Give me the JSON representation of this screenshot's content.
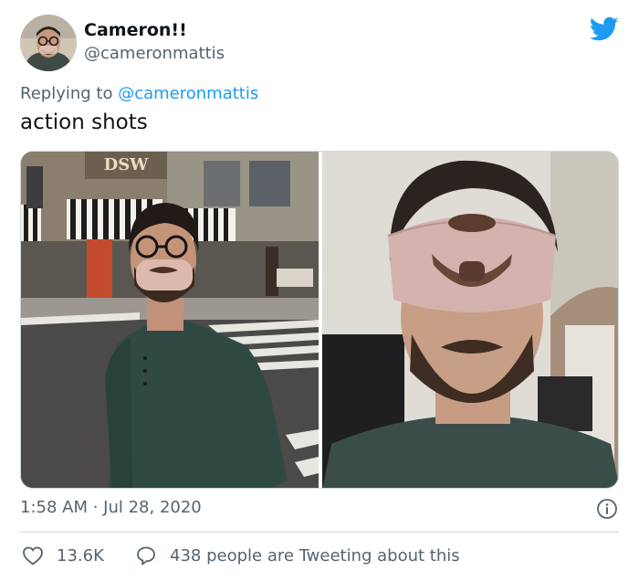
{
  "author": {
    "display_name": "Cameron!!",
    "handle": "@cameronmattis"
  },
  "reply": {
    "prefix": "Replying to",
    "mention": "@cameronmattis"
  },
  "tweet": {
    "text": "action shots",
    "timestamp": "1:58 AM · Jul 28, 2020"
  },
  "media": {
    "left_sign": "DSW"
  },
  "stats": {
    "likes": "13.6K",
    "conversation": "438 people are Tweeting about this"
  },
  "colors": {
    "brand": "#1d9bf0",
    "secondary_text": "#536471",
    "border": "#cfd9de"
  },
  "icons": [
    "twitter-bird-icon",
    "info-icon",
    "heart-icon",
    "speech-bubble-icon"
  ]
}
